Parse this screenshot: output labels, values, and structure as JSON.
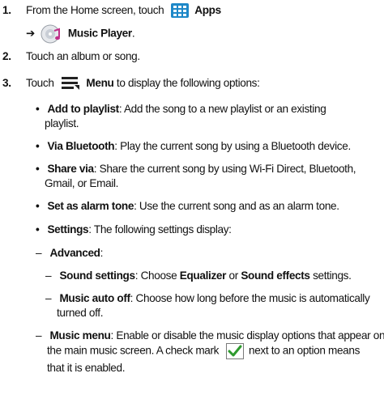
{
  "steps": [
    {
      "number": "1.",
      "line1_prefix": "From the Home screen, touch",
      "apps_label": "Apps",
      "arrow": "➔",
      "music_player_label": "Music Player",
      "line2_suffix": "."
    },
    {
      "number": "2.",
      "text": "Touch an album or song."
    },
    {
      "number": "3.",
      "prefix": "Touch",
      "menu_label": "Menu",
      "suffix": " to display the following options:"
    }
  ],
  "options": [
    {
      "bullet": "•",
      "label": "Add to playlist",
      "line1": ": Add the song to a new playlist or an existing",
      "line2": "playlist."
    },
    {
      "bullet": "•",
      "label": "Via Bluetooth",
      "line1": ": Play the current song by using a Bluetooth device."
    },
    {
      "bullet": "•",
      "label": "Share via",
      "line1": ": Share the current song by using Wi-Fi Direct, Bluetooth,",
      "line2": "Gmail, or Email."
    },
    {
      "bullet": "•",
      "label": "Set as alarm tone",
      "line1": ": Use the current song and as an alarm tone."
    },
    {
      "bullet": "•",
      "label": "Settings",
      "line1": ": The following settings display:"
    }
  ],
  "settings": {
    "dash": "–",
    "advanced_label": "Advanced",
    "advanced_suffix": ":",
    "sound_settings": {
      "label": "Sound settings",
      "text1": ": Choose ",
      "equalizer": "Equalizer",
      "text2": " or ",
      "sound_effects": "Sound effects",
      "text3": " settings."
    },
    "music_auto_off": {
      "label": "Music auto off",
      "line1": ": Choose how long before the music is automatically",
      "line2": "turned off."
    },
    "music_menu": {
      "label": "Music menu",
      "line1": ": Enable or disable the music display options that appear on",
      "line2": "the main music screen. A check mark",
      "line2_suffix": " next to an option means",
      "line3": "that it is enabled."
    }
  },
  "colors": {
    "apps_icon_bg": "#1e88c8",
    "checkmark_green": "#2e9a2e",
    "menu_icon": "#222222"
  }
}
